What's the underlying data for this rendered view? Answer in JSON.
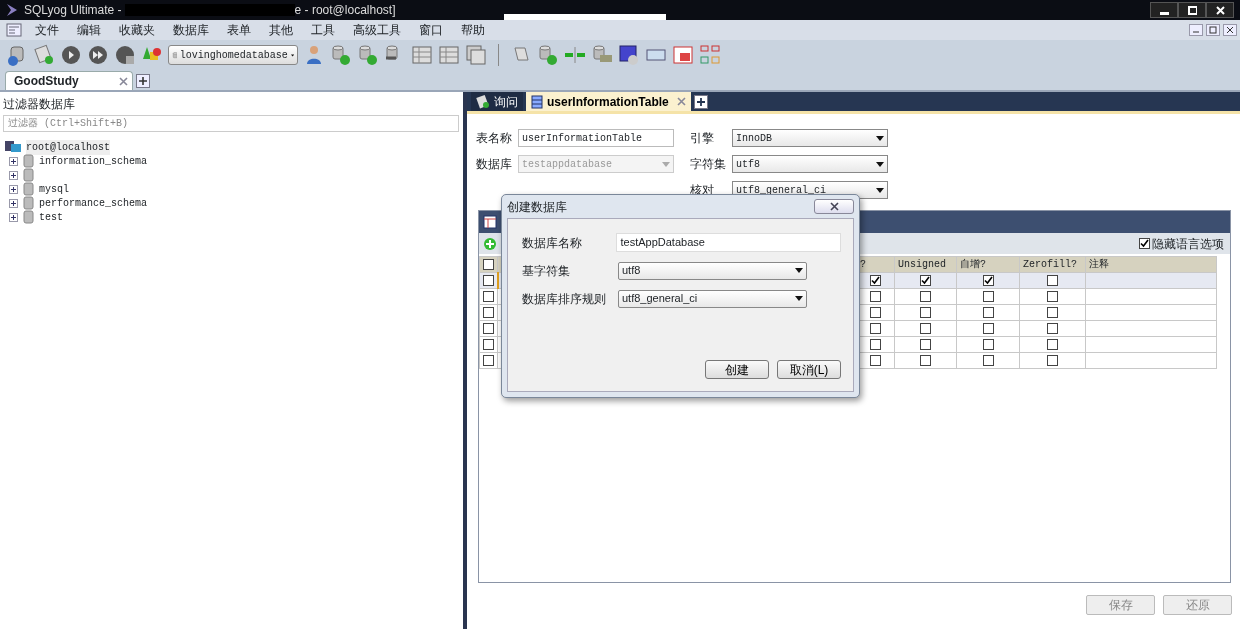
{
  "window": {
    "title_prefix": "SQLyog Ultimate -",
    "title_suffix": "e - root@localhost]"
  },
  "menu": [
    "文件",
    "编辑",
    "收藏夹",
    "数据库",
    "表单",
    "其他",
    "工具",
    "高级工具",
    "窗口",
    "帮助"
  ],
  "toolbar": {
    "database_selector": "lovinghomedatabase"
  },
  "connection_tabs": [
    {
      "label": "GoodStudy",
      "selected": true
    }
  ],
  "object_browser": {
    "title": "过滤器数据库",
    "filter_placeholder": "过滤器 (Ctrl+Shift+B)",
    "tree": [
      {
        "label": "root@localhost",
        "kind": "server",
        "selected": true,
        "children": [
          {
            "label": "information_schema",
            "kind": "database",
            "expanded": false,
            "selected": false
          },
          {
            "kind": "database",
            "expanded": false
          },
          {
            "label": "mysql",
            "kind": "database",
            "expanded": false,
            "selected": false
          },
          {
            "label": "performance_schema",
            "kind": "database",
            "expanded": false,
            "selected": false
          },
          {
            "label": "test",
            "kind": "database",
            "expanded": false,
            "selected": false
          }
        ]
      }
    ]
  },
  "editor_tabs": [
    {
      "label": "询问",
      "kind": "query",
      "selected": false
    },
    {
      "label": "userInformationTable",
      "kind": "table",
      "selected": true
    }
  ],
  "table_form": {
    "left": [
      {
        "label": "表名称",
        "value": "userInformationTable",
        "kind": "text",
        "disabled": false
      },
      {
        "label": "数据库",
        "value": "testappdatabase",
        "kind": "select",
        "disabled": true
      }
    ],
    "right": [
      {
        "label": "引擎",
        "value": "InnoDB",
        "kind": "select",
        "disabled": false
      },
      {
        "label": "字符集",
        "value": "utf8",
        "kind": "select",
        "disabled": false
      },
      {
        "label": "核对",
        "value": "utf8_general_ci",
        "kind": "select",
        "disabled": false
      }
    ]
  },
  "columns_grid": {
    "hide_language_options": {
      "label": "隐藏语言选项",
      "checked": true
    },
    "columns": [
      "?",
      "Unsigned",
      "自增?",
      "Zerofill?",
      "注释"
    ],
    "header_checked": false,
    "rows": [
      {
        "selected": true,
        "checked": false,
        "flag": true,
        "unsigned": true,
        "auto_increment": true,
        "zerofill": false
      },
      {
        "selected": false,
        "checked": false,
        "flag": false,
        "unsigned": false,
        "auto_increment": false,
        "zerofill": false
      },
      {
        "selected": false,
        "checked": false,
        "flag": false,
        "unsigned": false,
        "auto_increment": false,
        "zerofill": false
      },
      {
        "selected": false,
        "checked": false,
        "flag": false,
        "unsigned": false,
        "auto_increment": false,
        "zerofill": false
      },
      {
        "selected": false,
        "checked": false,
        "flag": false,
        "unsigned": false,
        "auto_increment": false,
        "zerofill": false
      },
      {
        "selected": false,
        "checked": false,
        "flag": false,
        "unsigned": false,
        "auto_increment": false,
        "zerofill": false
      }
    ]
  },
  "footer_buttons": [
    {
      "label": "保存",
      "disabled": true
    },
    {
      "label": "还原",
      "disabled": true
    }
  ],
  "dialog": {
    "title": "创建数据库",
    "fields": [
      {
        "label": "数据库名称",
        "value": "testAppDatabase",
        "kind": "text"
      },
      {
        "label": "基字符集",
        "value": "utf8",
        "kind": "select"
      },
      {
        "label": "数据库排序规则",
        "value": "utf8_general_ci",
        "kind": "select"
      }
    ],
    "buttons": [
      "创建",
      "取消(L)"
    ]
  }
}
